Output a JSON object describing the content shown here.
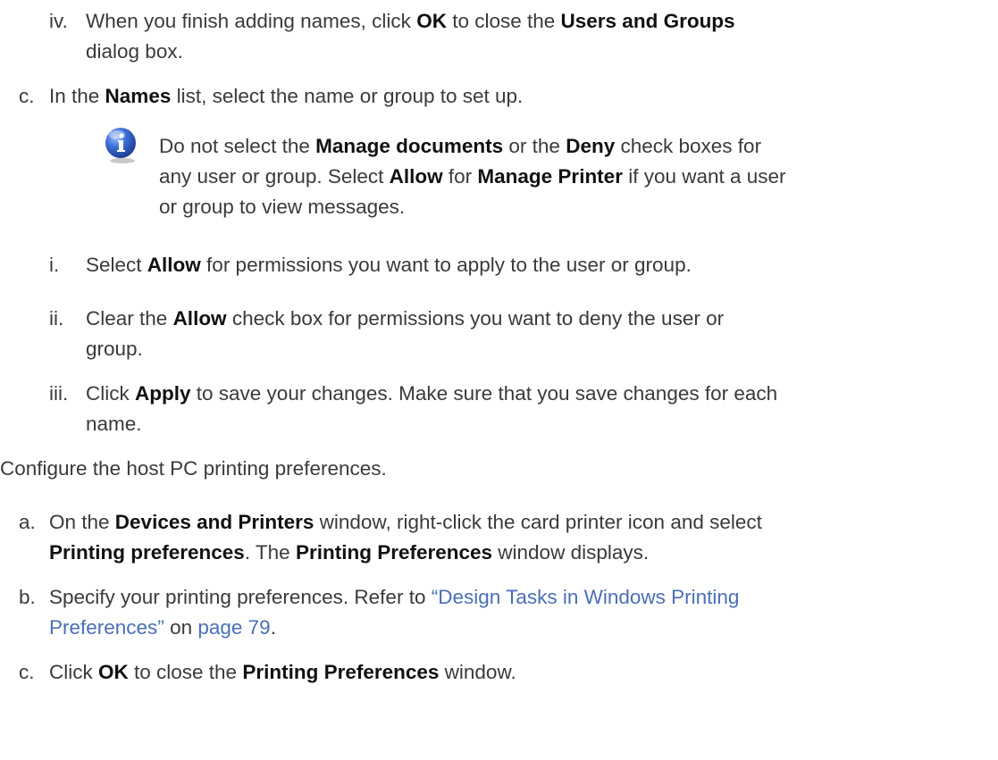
{
  "step_iv": {
    "label": "iv.",
    "t1": "When you finish adding names, click ",
    "b1": "OK",
    "t2": " to close the ",
    "b2": "Users and Groups",
    "t3": "dialog box."
  },
  "step_c": {
    "label": "c.",
    "t1": "In the ",
    "b1": "Names",
    "t2": " list, select the name or group to set up."
  },
  "note": {
    "icon": "info-icon",
    "t1": "Do not select the ",
    "b1": "Manage documents",
    "t2": " or the ",
    "b2": "Deny",
    "t3": " check boxes for",
    "t4": "any user or group. Select ",
    "b3": "Allow",
    "t5": " for ",
    "b4": "Manage Printer",
    "t6": " if you want a user",
    "t7": "or group to view messages."
  },
  "step_i": {
    "label": "i.",
    "t1": "Select ",
    "b1": "Allow",
    "t2": " for permissions you want to apply to the user or group."
  },
  "step_ii": {
    "label": "ii.",
    "t1": "Clear the ",
    "b1": "Allow",
    "t2": " check box for permissions you want to deny the user or",
    "t3": "group."
  },
  "step_iii": {
    "label": "iii.",
    "t1": "Click ",
    "b1": "Apply",
    "t2": " to save your changes. Make sure that you save changes for each",
    "t3": "name."
  },
  "configure": {
    "text": "Configure the host PC printing preferences."
  },
  "step_a": {
    "label": "a.",
    "t1": "On the ",
    "b1": "Devices and Printers",
    "t2": " window, right-click the card printer icon and select",
    "b2": "Printing preferences",
    "t3": ". The ",
    "b3": "Printing Preferences",
    "t4": " window displays."
  },
  "step_b": {
    "label": "b.",
    "t1": "Specify your printing preferences. Refer to ",
    "link1a": "“Design Tasks in Windows Printing",
    "link1b": "Preferences”",
    "t2": " on ",
    "link2": "page 79",
    "t3": "."
  },
  "step_c2": {
    "label": "c.",
    "t1": "Click ",
    "b1": "OK",
    "t2": " to close the ",
    "b2": "Printing Preferences",
    "t3": " window."
  },
  "colors": {
    "text": "#3a3a3a",
    "bold": "#111111",
    "link": "#4a6fb5",
    "icon": "#2f55b4"
  }
}
